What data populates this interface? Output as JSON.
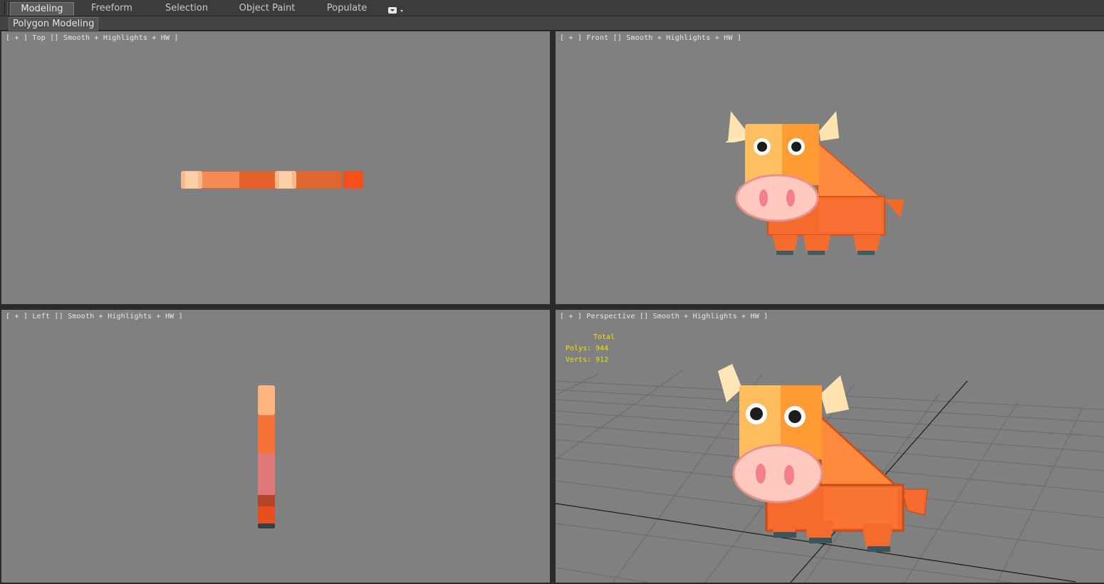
{
  "ribbon": {
    "tabs": [
      {
        "label": "Modeling",
        "active": true
      },
      {
        "label": "Freeform",
        "active": false
      },
      {
        "label": "Selection",
        "active": false
      },
      {
        "label": "Object Paint",
        "active": false
      },
      {
        "label": "Populate",
        "active": false
      }
    ],
    "dropdown_icon": "options-dropdown-icon",
    "panel_label": "Polygon Modeling"
  },
  "viewports": {
    "top": {
      "label": "[ + ] Top [] Smooth + Highlights + HW ]"
    },
    "front": {
      "label": "[ + ] Front [] Smooth + Highlights + HW ]"
    },
    "left": {
      "label": "[ + ] Left [] Smooth + Highlights + HW ]"
    },
    "perspective": {
      "label": "[ + ] Perspective [] Smooth + Highlights + HW ]"
    }
  },
  "stats": {
    "total_label": "Total",
    "polys": "Polys: 944",
    "verts": "Verts: 912"
  },
  "colors": {
    "viewport_bg": "#808080",
    "cow_orange": "#f56b2e",
    "cow_light": "#ff9a4a",
    "nose_pink": "#ffc4bc",
    "horn": "#ffe6b6",
    "stats_yellow": "#f0e000"
  }
}
